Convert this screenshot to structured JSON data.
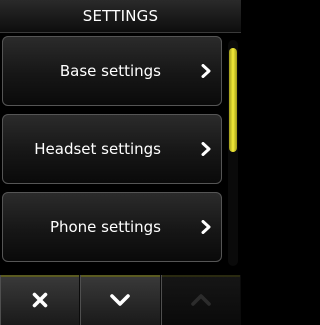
{
  "header": {
    "title": "SETTINGS"
  },
  "items": [
    {
      "label": "Base settings",
      "icon": "chevron-right-icon"
    },
    {
      "label": "Headset settings",
      "icon": "chevron-right-icon"
    },
    {
      "label": "Phone settings",
      "icon": "chevron-right-icon"
    }
  ],
  "footer": {
    "buttons": [
      {
        "icon": "close-icon",
        "enabled": true
      },
      {
        "icon": "chevron-down-icon",
        "enabled": true
      },
      {
        "icon": "chevron-up-icon",
        "enabled": false
      }
    ]
  },
  "colors": {
    "accent": "#f4ec39",
    "background": "#000000"
  }
}
